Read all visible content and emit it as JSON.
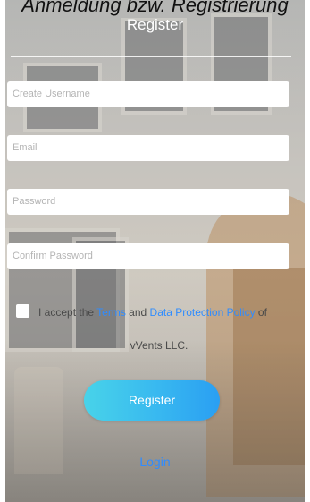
{
  "caption": "Anmeldung bzw. Registrierung",
  "header": {
    "title": "Register"
  },
  "form": {
    "username_placeholder": "Create Username",
    "email_placeholder": "Email",
    "password_placeholder": "Password",
    "confirm_placeholder": "Confirm Password"
  },
  "terms": {
    "checked": false,
    "prefix": "I accept the ",
    "terms_link": "Terms",
    "and": " and ",
    "policy_link": "Data Protection Policy",
    "suffix": " of",
    "line2": "vVents LLC."
  },
  "actions": {
    "register_label": "Register",
    "login_label": "Login"
  },
  "colors": {
    "accent": "#2f8cff",
    "button_gradient_start": "#48d3e9",
    "button_gradient_end": "#2a9ff2"
  }
}
